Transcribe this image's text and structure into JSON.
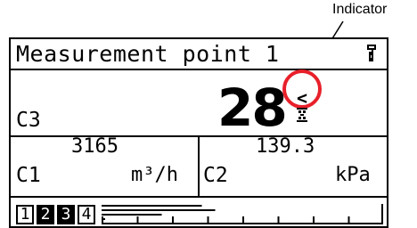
{
  "callout": {
    "label": "Indicator",
    "ring_color": "#e8202a"
  },
  "display": {
    "title": "Measurement point 1",
    "lock_icon": "lock-icon",
    "main": {
      "value": "28",
      "channel": "C3",
      "indicator_symbol": "<",
      "busy_icon": "hourglass-icon"
    },
    "c1": {
      "value": "3165",
      "label": "C1",
      "unit": "m³/h"
    },
    "c2": {
      "value": "139.3",
      "label": "C2",
      "unit": "kPa"
    },
    "pages": [
      {
        "label": "1",
        "active": false
      },
      {
        "label": "2",
        "active": true
      },
      {
        "label": "3",
        "active": true
      },
      {
        "label": "4",
        "active": false
      }
    ],
    "bargraph": {
      "segments": 4,
      "level_top": 0.75,
      "level_mid": 0.85,
      "level_low": 0.45
    }
  }
}
